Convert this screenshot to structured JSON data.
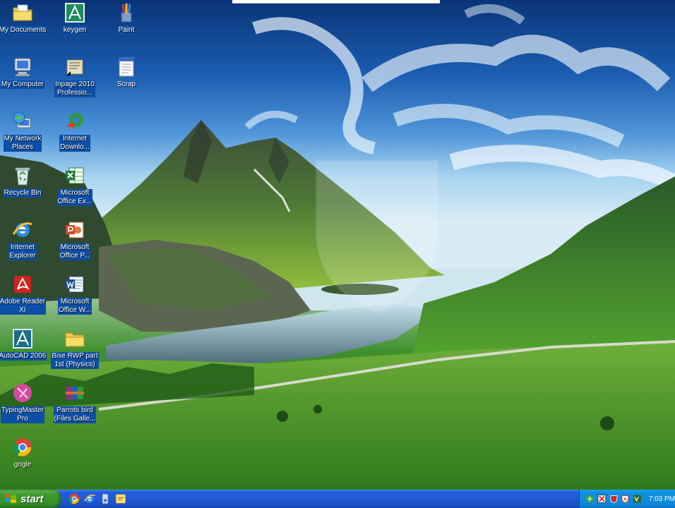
{
  "desktop": {
    "icons": [
      {
        "label": "My Documents",
        "icon": "folder-documents-icon"
      },
      {
        "label": "keygen",
        "icon": "keygen-app-icon"
      },
      {
        "label": "Paint",
        "icon": "paint-brushes-icon"
      },
      {
        "label": "My Computer",
        "icon": "computer-icon"
      },
      {
        "label": "Inpage 2010\nProfessio...",
        "icon": "inpage-shortcut-icon"
      },
      {
        "label": "Scrap",
        "icon": "document-icon"
      },
      {
        "label": "My Network\nPlaces",
        "icon": "network-globe-icon"
      },
      {
        "label": "Internet\nDownlo...",
        "icon": "internet-download-manager-icon"
      },
      {
        "label": "Recycle Bin",
        "icon": "recycle-bin-icon"
      },
      {
        "label": "Microsoft\nOffice Ex...",
        "icon": "excel-icon"
      },
      {
        "label": "Internet\nExplorer",
        "icon": "internet-explorer-icon"
      },
      {
        "label": "Microsoft\nOffice P...",
        "icon": "powerpoint-icon"
      },
      {
        "label": "Adobe Reader\nXI",
        "icon": "adobe-reader-icon"
      },
      {
        "label": "Microsoft\nOffice W...",
        "icon": "word-icon"
      },
      {
        "label": "AutoCAD 2006",
        "icon": "autocad-icon"
      },
      {
        "label": "Bise RWP part\n1st (Physics)",
        "icon": "folder-icon"
      },
      {
        "label": "TypingMaster\nPro",
        "icon": "typingmaster-icon"
      },
      {
        "label": "Parrots bird\n(Files Galle...",
        "icon": "winrar-archive-icon"
      },
      {
        "label": "gogle",
        "icon": "chrome-icon"
      }
    ]
  },
  "taskbar": {
    "start_label": "start",
    "quick_launch": [
      "chrome-icon",
      "internet-explorer-icon",
      "media-player-icon",
      "messenger-icon"
    ],
    "tray_icons": [
      "network-icon",
      "tray-app-icon",
      "shield-icon",
      "shield-red-icon",
      "virtual-desktop-icon"
    ],
    "clock": "7:03 PM"
  },
  "colors": {
    "taskbar_blue": "#245edc",
    "start_green": "#3c9a2e",
    "tray_blue": "#0d86d8",
    "label_highlight": "#0b4fa8"
  }
}
